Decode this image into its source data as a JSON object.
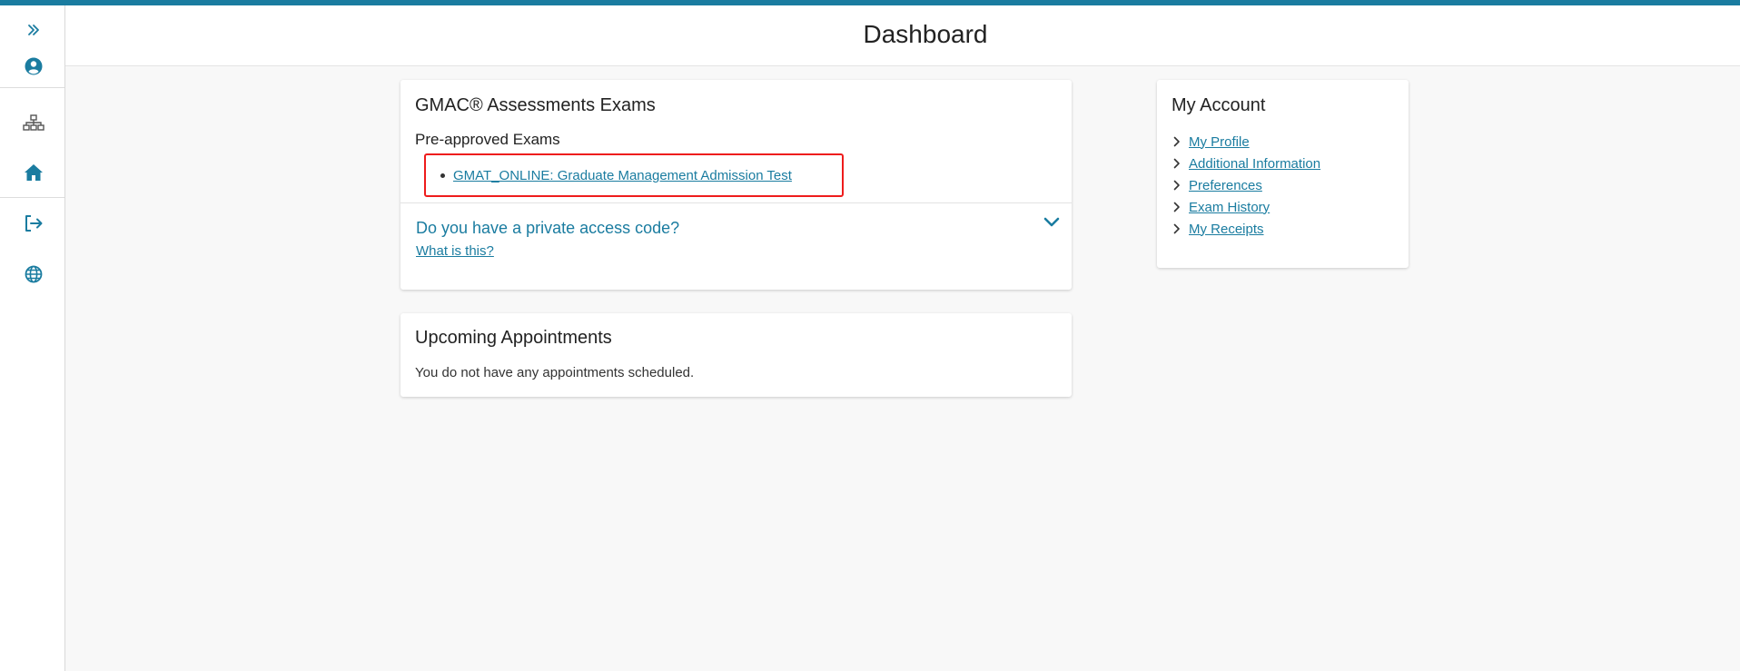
{
  "header": {
    "title": "Dashboard"
  },
  "sidebar": {
    "items": [
      {
        "name": "expand",
        "icon": "double-chevron-right-icon"
      },
      {
        "name": "profile",
        "icon": "user-circle-icon"
      },
      {
        "name": "sitemap",
        "icon": "sitemap-icon"
      },
      {
        "name": "home",
        "icon": "home-icon"
      },
      {
        "name": "sign-out",
        "icon": "sign-out-icon"
      },
      {
        "name": "language",
        "icon": "globe-icon"
      }
    ]
  },
  "exams_card": {
    "title": "GMAC® Assessments Exams",
    "preapproved_label": "Pre-approved Exams",
    "exams": [
      "GMAT_ONLINE: Graduate Management Admission Test"
    ],
    "access_code_question": "Do you have a private access code?",
    "what_is_this_link": "What is this?"
  },
  "appointments_card": {
    "title": "Upcoming Appointments",
    "message": "You do not have any appointments scheduled."
  },
  "account_card": {
    "title": "My Account",
    "links": [
      "My Profile",
      "Additional Information",
      "Preferences",
      "Exam History",
      "My Receipts"
    ]
  },
  "colors": {
    "accent": "#1a7ca0",
    "highlight_border": "#ee1c1c",
    "background": "#f8f8f8"
  }
}
